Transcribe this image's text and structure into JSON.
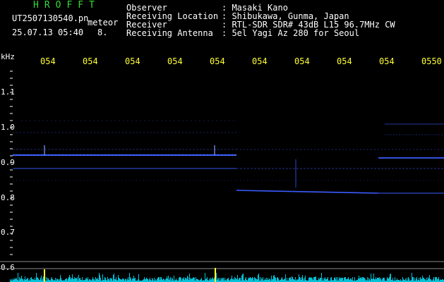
{
  "header": {
    "brand": "HROFFT",
    "file_name": "UT2507130540.pn",
    "file_suffix": "meteor",
    "date_time": "25.07.13 05:40",
    "count": "8.",
    "info": [
      {
        "label": "Observer",
        "value": ": Masaki Kano"
      },
      {
        "label": "Receiving Location",
        "value": ": Shibukawa, Gunma, Japan"
      },
      {
        "label": "Receiver",
        "value": ": RTL-SDR SDR# 43dB L15 96.7MHz CW"
      },
      {
        "label": "Receiving Antenna",
        "value": ": 5el Yagi Az 280 for Seoul"
      }
    ]
  },
  "axis": {
    "unit": "kHz",
    "y_labels": [
      "1.1",
      "1.0",
      "0.9",
      "0.8",
      "0.7",
      "0.6"
    ],
    "time_labels": [
      "054",
      "054",
      "054",
      "054",
      "054",
      "054",
      "054",
      "054",
      "054",
      "0550"
    ]
  },
  "colors": {
    "background": "#000000",
    "signal": "#3a5cff",
    "guide_line": "#8a8a8a",
    "noise": "#00e5ff",
    "peak": "#ffff33"
  }
}
